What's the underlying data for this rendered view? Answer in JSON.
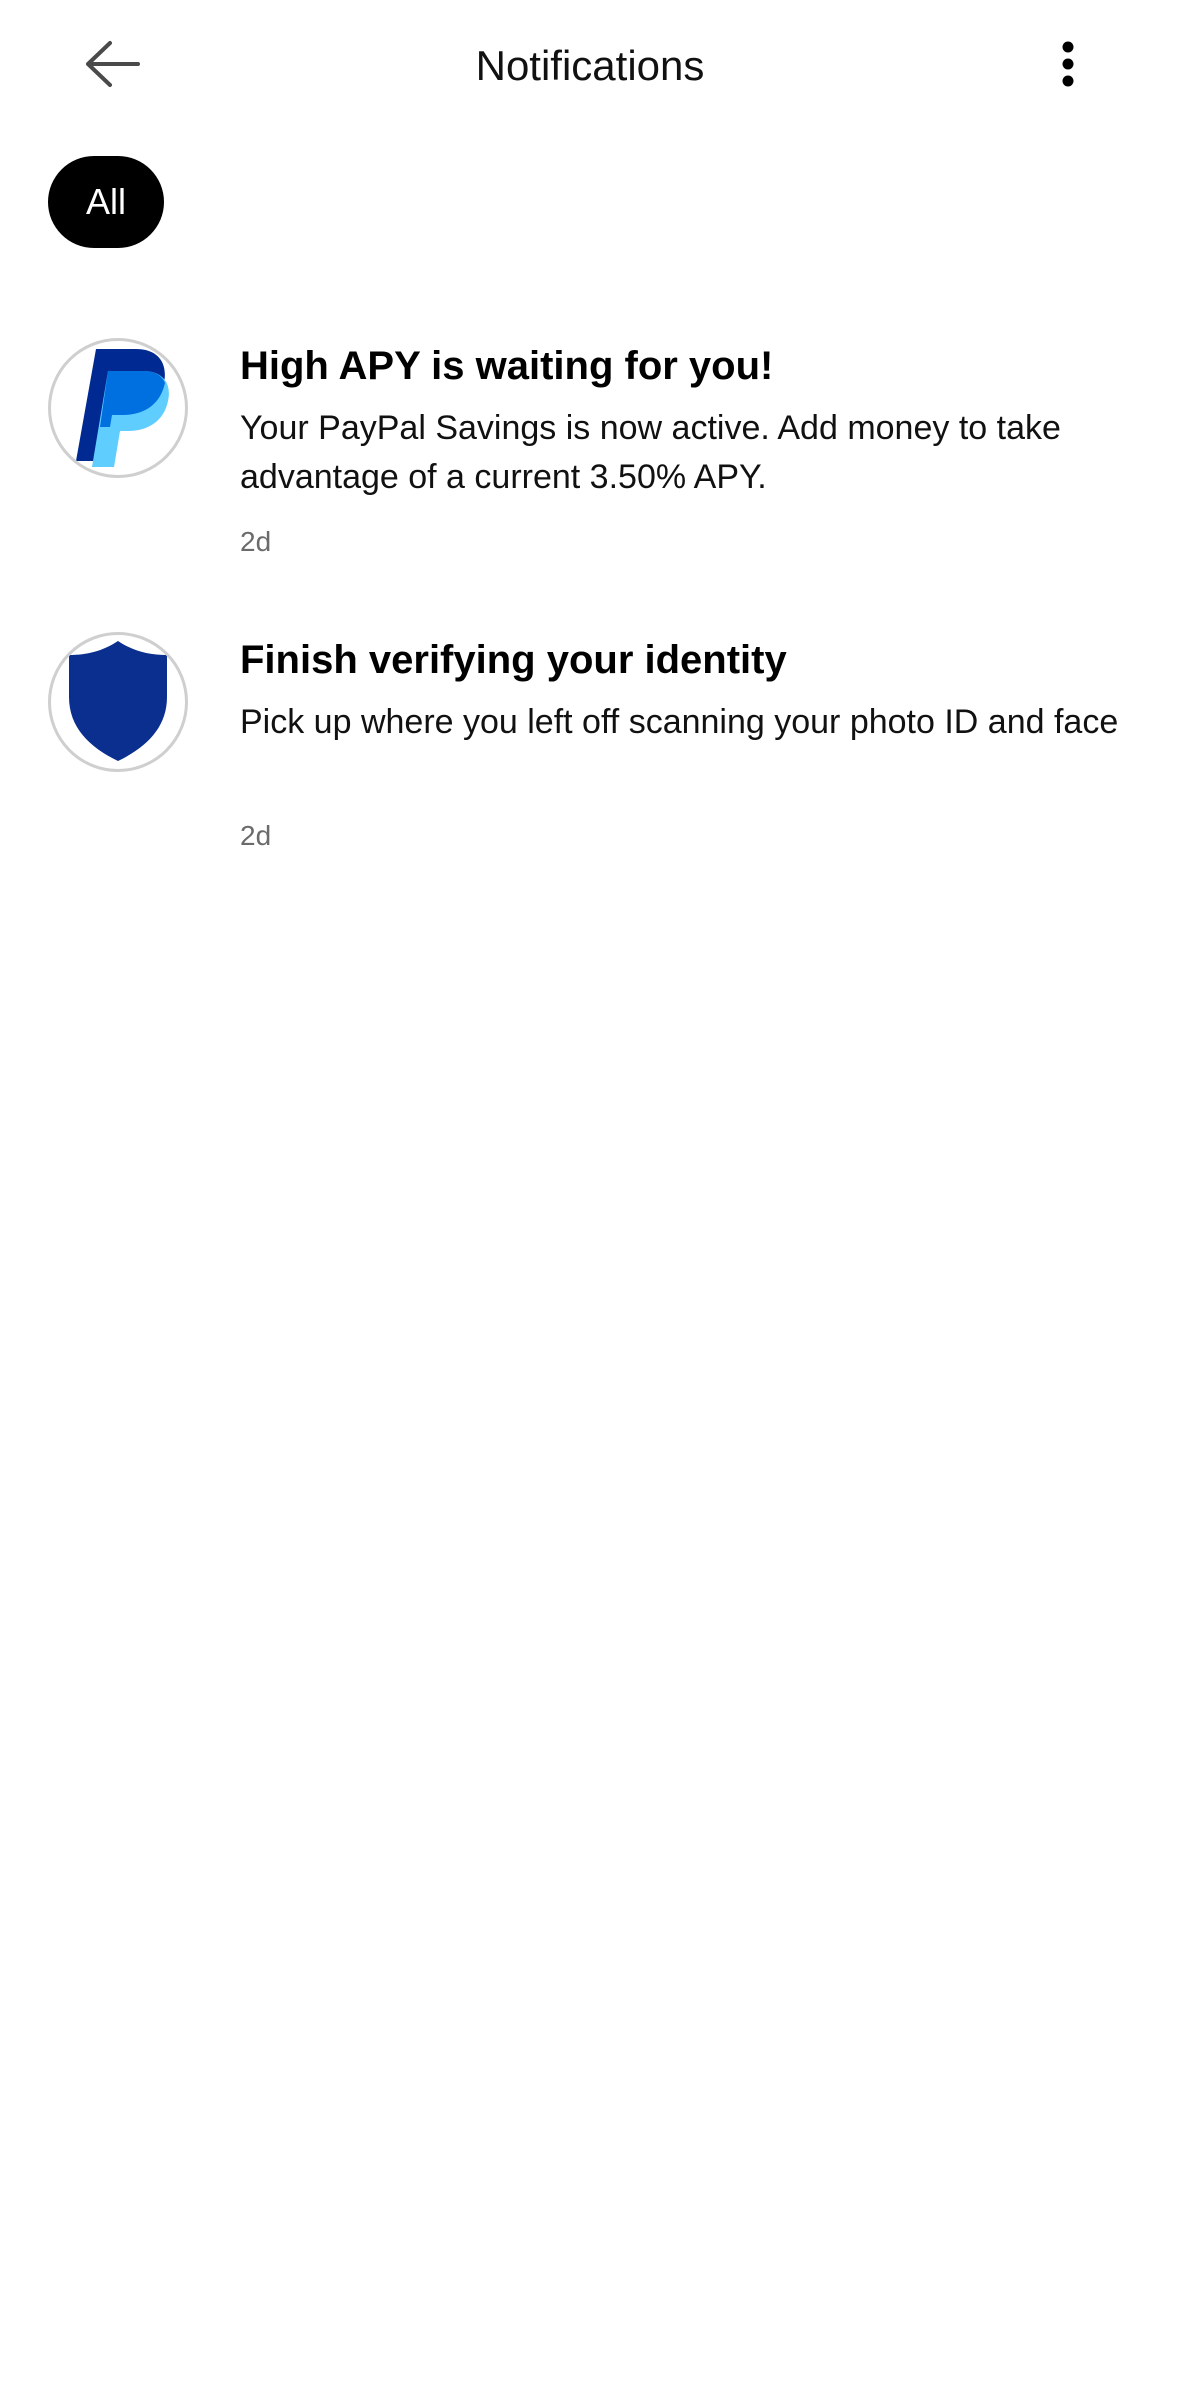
{
  "header": {
    "title": "Notifications",
    "back_icon": "arrow-left-icon",
    "more_icon": "more-vertical-icon"
  },
  "filters": {
    "active": "All"
  },
  "notifications": [
    {
      "icon": "paypal-logo-icon",
      "title": "High APY is waiting for you!",
      "body": "Your PayPal Savings is now active. Add money to take advantage of a current 3.50% APY.",
      "time": "2d"
    },
    {
      "icon": "shield-icon",
      "title": "Finish verifying your identity",
      "body": "Pick up where you left off scanning your photo ID and face",
      "time": "2d"
    }
  ],
  "colors": {
    "chip_bg": "#000000",
    "paypal_dark": "#002991",
    "paypal_mid": "#0070e0",
    "paypal_light": "#60cdff",
    "shield": "#0b2f8f"
  }
}
